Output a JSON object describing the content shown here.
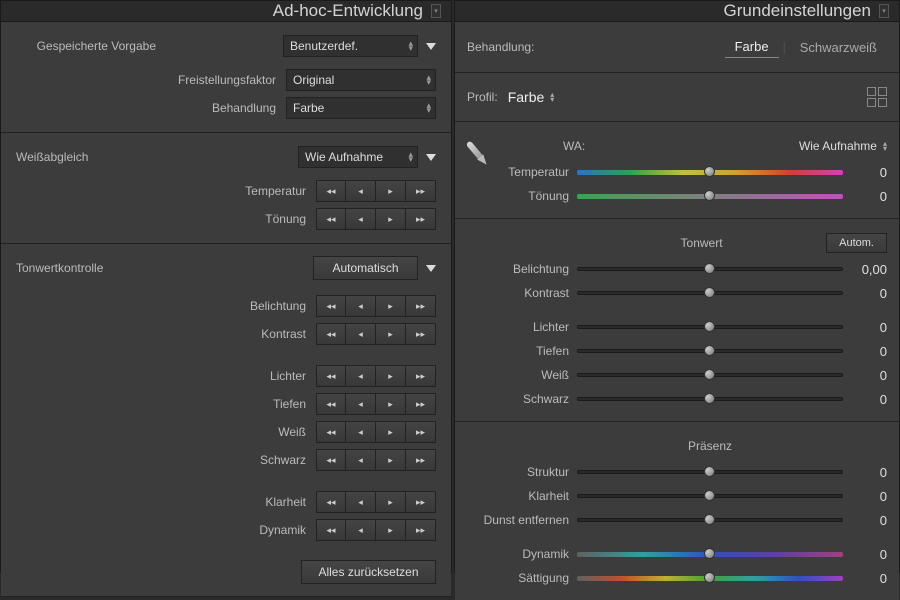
{
  "left": {
    "title": "Ad-hoc-Entwicklung",
    "preset_label": "Gespeicherte Vorgabe",
    "preset_value": "Benutzerdef.",
    "crop_label": "Freistellungsfaktor",
    "crop_value": "Original",
    "treatment_label": "Behandlung",
    "treatment_value": "Farbe",
    "wb_label": "Weißabgleich",
    "wb_value": "Wie Aufnahme",
    "temp_label": "Temperatur",
    "tint_label": "Tönung",
    "tone_label": "Tonwertkontrolle",
    "auto_btn": "Automatisch",
    "exposure": "Belichtung",
    "contrast": "Kontrast",
    "highlights": "Lichter",
    "shadows": "Tiefen",
    "whites": "Weiß",
    "blacks": "Schwarz",
    "clarity": "Klarheit",
    "vibrance": "Dynamik",
    "reset_btn": "Alles zurücksetzen"
  },
  "right": {
    "title": "Grundeinstellungen",
    "treatment_label": "Behandlung:",
    "color": "Farbe",
    "bw": "Schwarzweiß",
    "profile_label": "Profil:",
    "profile_value": "Farbe",
    "wb_label": "WA:",
    "wb_value": "Wie Aufnahme",
    "temp_label": "Temperatur",
    "temp_val": "0",
    "tint_label": "Tönung",
    "tint_val": "0",
    "tone_label": "Tonwert",
    "auto_btn": "Autom.",
    "exposure": "Belichtung",
    "exposure_val": "0,00",
    "contrast": "Kontrast",
    "contrast_val": "0",
    "highlights": "Lichter",
    "highlights_val": "0",
    "shadows": "Tiefen",
    "shadows_val": "0",
    "whites": "Weiß",
    "whites_val": "0",
    "blacks": "Schwarz",
    "blacks_val": "0",
    "presence_label": "Präsenz",
    "texture": "Struktur",
    "texture_val": "0",
    "clarity": "Klarheit",
    "clarity_val": "0",
    "dehaze": "Dunst entfernen",
    "dehaze_val": "0",
    "vibrance": "Dynamik",
    "vibrance_val": "0",
    "saturation": "Sättigung",
    "saturation_val": "0"
  }
}
